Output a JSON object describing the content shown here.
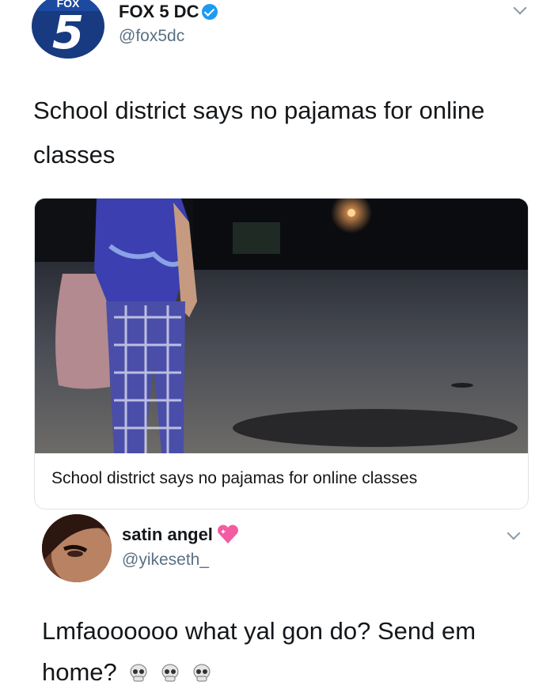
{
  "tweet1": {
    "avatar_band": "FOX",
    "avatar_number": "5",
    "display_name": "FOX 5 DC",
    "handle": "@fox5dc",
    "text": "School district says no pajamas for online classes",
    "card": {
      "caption": "School district says no pajamas for online classes"
    }
  },
  "tweet2": {
    "display_name": "satin angel",
    "handle": "@yikeseth_",
    "text": "Lmfaoooooo what yal gon do? Send em home?",
    "name_emoji": "sparkling-heart-icon",
    "trailing_emoji": [
      "skull-icon",
      "skull-icon",
      "skull-icon"
    ]
  }
}
